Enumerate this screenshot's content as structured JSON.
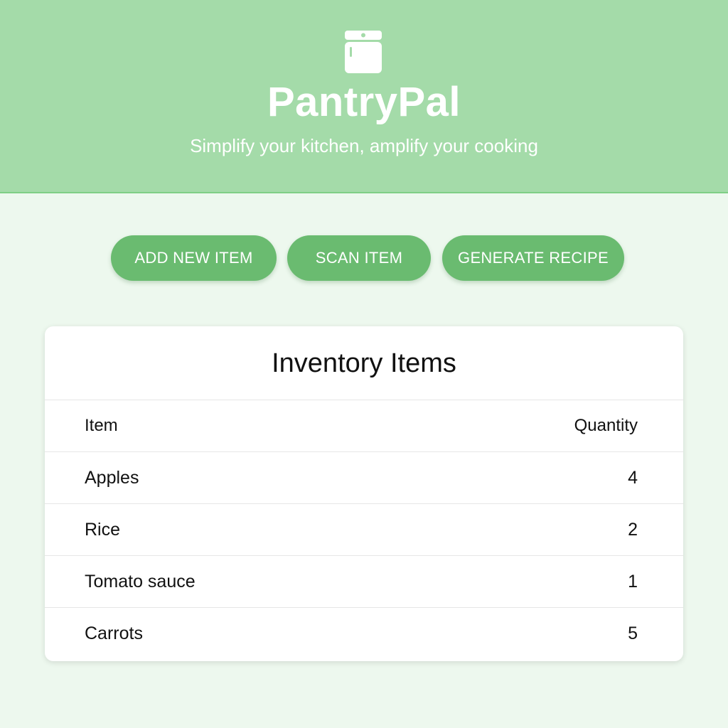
{
  "header": {
    "title": "PantryPal",
    "tagline": "Simplify your kitchen, amplify your cooking",
    "logo_icon": "pantry-icon",
    "background_color": "#a4dba9"
  },
  "actions": {
    "add_label": "ADD NEW ITEM",
    "scan_label": "SCAN ITEM",
    "recipe_label": "GENERATE RECIPE",
    "button_color": "#6abb70"
  },
  "inventory": {
    "title": "Inventory Items",
    "columns": [
      "Item",
      "Quantity"
    ],
    "rows": [
      {
        "item": "Apples",
        "quantity": "4"
      },
      {
        "item": "Rice",
        "quantity": "2"
      },
      {
        "item": "Tomato sauce",
        "quantity": "1"
      },
      {
        "item": "Carrots",
        "quantity": "5"
      }
    ]
  }
}
